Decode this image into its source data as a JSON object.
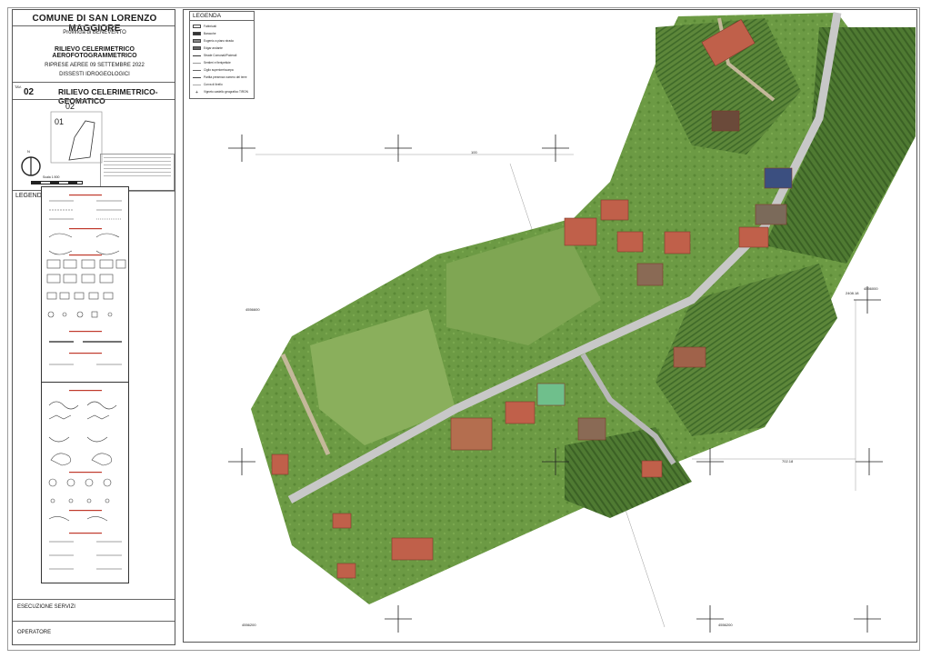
{
  "title_block": {
    "municipality": "COMUNE DI SAN LORENZO MAGGIORE",
    "province": "Provincia di BENEVENTO",
    "survey_type": "RILIEVO CELERIMETRICO AEROFOTOGRAMMETRICO",
    "shots": "RIPRESE AEREE 09 SETTEMBRE 2022",
    "subtitle": "DISSESTI IDROGEOLOGICI",
    "table_label": "TAV.",
    "table_number": "02",
    "table_title": "RILIEVO CELERIMETRICO-GEOMATICO",
    "keymap_labels": [
      "02",
      "01"
    ],
    "north_label": "N",
    "scale_label": "Scala 1:500",
    "legend_label": "LEGENDA",
    "execution_label": "ESECUZIONE SERVIZI",
    "operator_label": "OPERATORE"
  },
  "map": {
    "legend_title": "LEGENDA",
    "legend_items": [
      "Fabbricati",
      "Baracche",
      "Eugenio a piano strada",
      "Edgar andante",
      "Strade Comunali/Poderali",
      "Sentieri e fienipettoie",
      "Ciglio superiore/scarpa",
      "Partita presenza numero del terre",
      "Curva di livello",
      "Vigneto castello geografico TIRON"
    ],
    "dimension_labels": [
      "100",
      "702.18"
    ],
    "grid_coords": [
      "4556600",
      "4556200",
      "4556200",
      "4556000",
      "2408.18"
    ],
    "colors": {
      "vegetation": "#5e8a3a",
      "vegetation_dark": "#3f6b2a",
      "road": "#bfbfbf",
      "roof": "#c0604a",
      "frame": "#555555"
    }
  }
}
